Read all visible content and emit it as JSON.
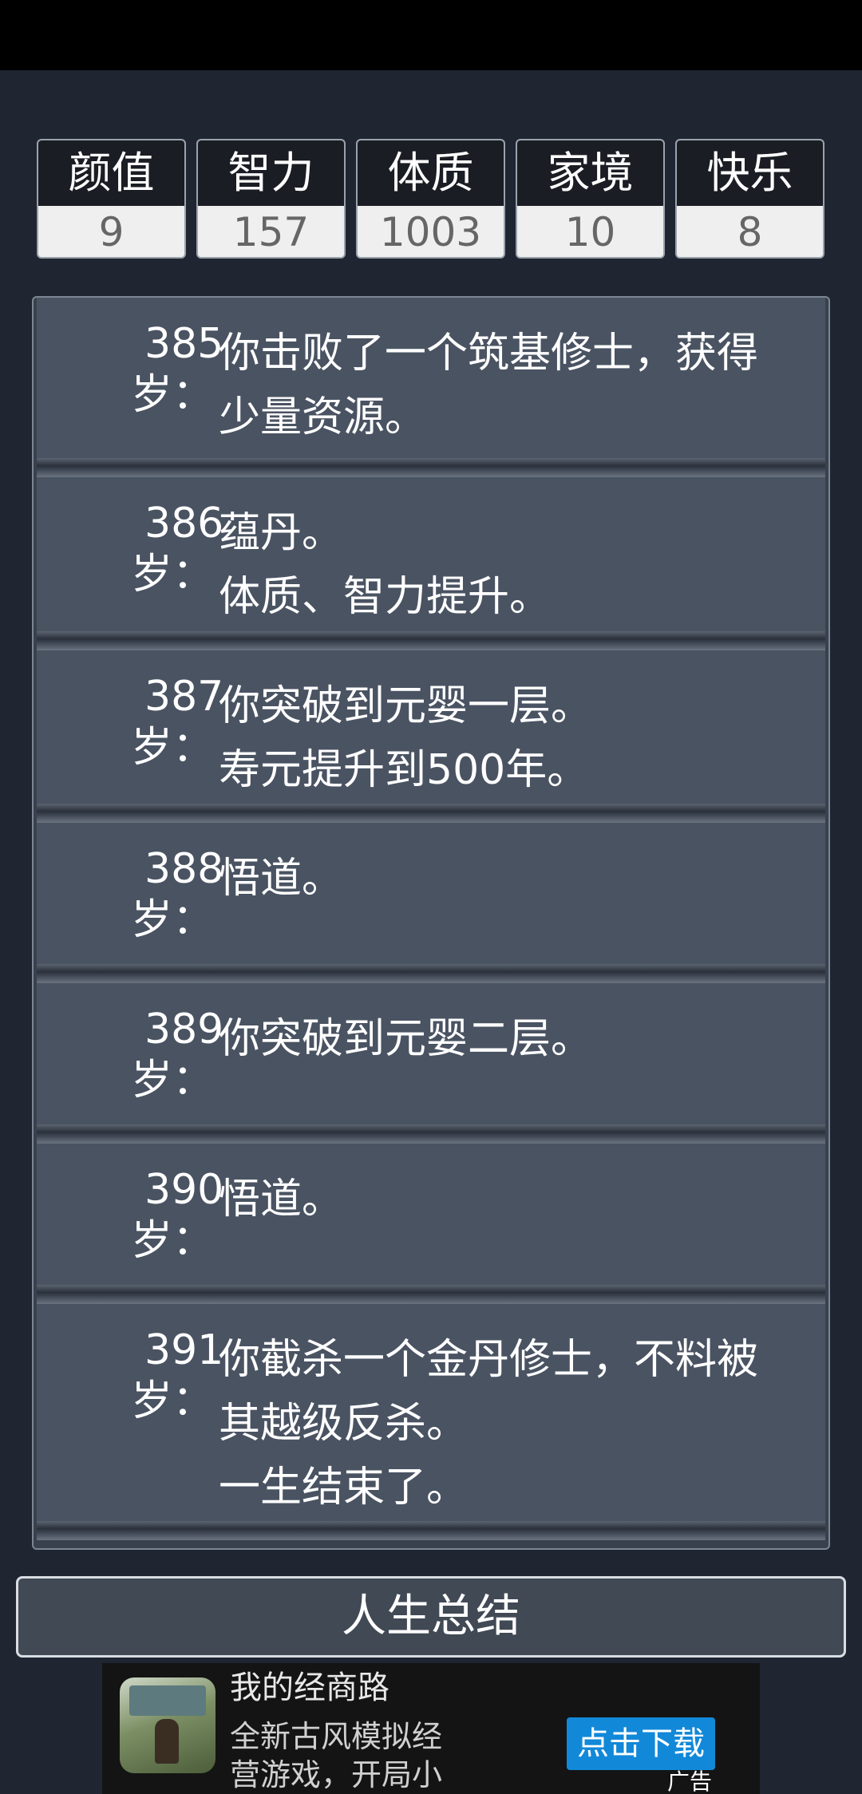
{
  "stats": [
    {
      "label": "颜值",
      "value": "9"
    },
    {
      "label": "智力",
      "value": "157"
    },
    {
      "label": "体质",
      "value": "1003"
    },
    {
      "label": "家境",
      "value": "10"
    },
    {
      "label": "快乐",
      "value": "8"
    }
  ],
  "age_suffix": "岁：",
  "events": [
    {
      "age": "385",
      "lines": [
        "你击败了一个筑基修士，获得",
        "少量资源。"
      ]
    },
    {
      "age": "386",
      "lines": [
        "蕴丹。",
        "体质、智力提升。"
      ]
    },
    {
      "age": "387",
      "lines": [
        "你突破到元婴一层。",
        "寿元提升到500年。"
      ]
    },
    {
      "age": "388",
      "lines": [
        "悟道。"
      ]
    },
    {
      "age": "389",
      "lines": [
        "你突破到元婴二层。"
      ]
    },
    {
      "age": "390",
      "lines": [
        "悟道。"
      ]
    },
    {
      "age": "391",
      "lines": [
        "你截杀一个金丹修士，不料被",
        "其越级反杀。",
        "一生结束了。"
      ]
    }
  ],
  "summary_button": "人生总结",
  "ad": {
    "title": "我的经商路",
    "description": "全新古风模拟经营游戏，开局小掌柜，要",
    "cta": "点击下载",
    "tag": "广告",
    "icon": "game-app-icon"
  }
}
